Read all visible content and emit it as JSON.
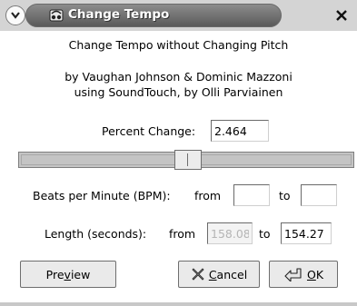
{
  "window": {
    "title": "Change Tempo"
  },
  "header": {
    "line1": "Change Tempo without Changing Pitch",
    "line2": "by Vaughan Johnson & Dominic Mazzoni",
    "line3": "using SoundTouch, by Olli Parviainen"
  },
  "percent": {
    "label": "Percent Change:",
    "value": "2.464"
  },
  "slider": {
    "level_fraction": 0.5
  },
  "bpm": {
    "label": "Beats per Minute (BPM):",
    "from_label": "from",
    "from_value": "",
    "to_label": "to",
    "to_value": ""
  },
  "length": {
    "label": "Length (seconds):",
    "from_label": "from",
    "from_value": "158.08",
    "to_label": "to",
    "to_value": "154.27"
  },
  "buttons": {
    "preview_pre": "Pre",
    "preview_mn": "v",
    "preview_post": "iew",
    "cancel_mn": "C",
    "cancel_post": "ancel",
    "ok_mn": "O",
    "ok_post": "K"
  },
  "icons": {
    "menu": "chevron-down-icon",
    "title": "audio-app-icon",
    "close": "close-icon",
    "cancel": "cancel-icon",
    "ok": "ok-arrow-icon"
  }
}
